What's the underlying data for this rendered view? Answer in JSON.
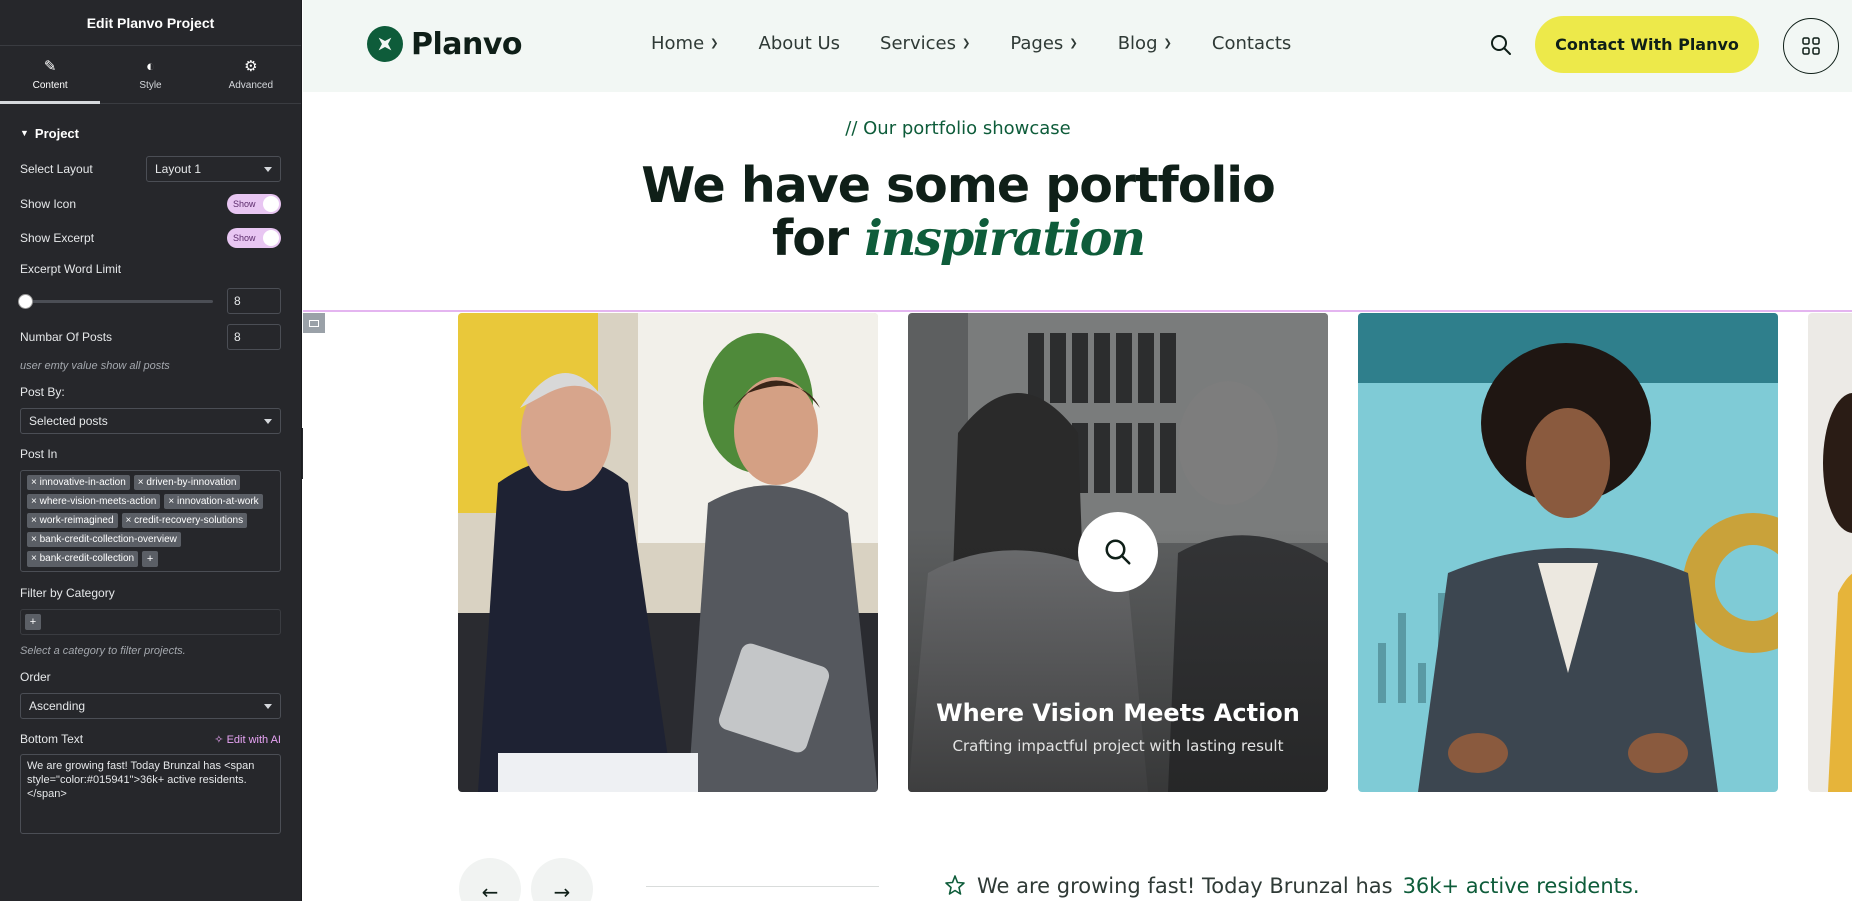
{
  "editor": {
    "title": "Edit Planvo Project",
    "tabs": [
      {
        "label": "Content",
        "icon": "pencil-icon"
      },
      {
        "label": "Style",
        "icon": "half-circle-icon"
      },
      {
        "label": "Advanced",
        "icon": "gear-icon"
      }
    ],
    "section": "Project",
    "layout_label": "Select Layout",
    "layout_value": "Layout 1",
    "show_icon_label": "Show Icon",
    "show_icon_value": "Show",
    "show_excerpt_label": "Show Excerpt",
    "show_excerpt_value": "Show",
    "excerpt_limit_label": "Excerpt Word Limit",
    "excerpt_limit_value": "8",
    "posts_label": "Numbar Of Posts",
    "posts_value": "8",
    "posts_hint": "user emty value show all posts",
    "post_by_label": "Post By:",
    "post_by_value": "Selected posts",
    "post_in_label": "Post In",
    "post_in_tags": [
      "innovative-in-action",
      "driven-by-innovation",
      "where-vision-meets-action",
      "innovation-at-work",
      "work-reimagined",
      "credit-recovery-solutions",
      "bank-credit-collection-overview",
      "bank-credit-collection"
    ],
    "filter_label": "Filter by Category",
    "filter_hint": "Select a category to filter projects.",
    "order_label": "Order",
    "order_value": "Ascending",
    "bottom_text_label": "Bottom Text",
    "edit_ai_label": "Edit with AI",
    "bottom_text_value": "We are growing fast! Today Brunzal has <span style=\"color:#015941\">36k+ active residents.</span>"
  },
  "site": {
    "logo": "Planvo",
    "menu": [
      {
        "label": "Home",
        "dropdown": true
      },
      {
        "label": "About Us",
        "dropdown": false
      },
      {
        "label": "Services",
        "dropdown": true
      },
      {
        "label": "Pages",
        "dropdown": true
      },
      {
        "label": "Blog",
        "dropdown": true
      },
      {
        "label": "Contacts",
        "dropdown": false
      }
    ],
    "cta": "Contact With Planvo",
    "subtitle": "// Our portfolio showcase",
    "heading_line1": "We have some portfolio",
    "heading_line2_plain": "for",
    "heading_line2_italic": "inspiration",
    "card_title": "Where Vision Meets Action",
    "card_excerpt": "Crafting impactful project with lasting result",
    "bottom_prefix": "We are growing fast! Today Brunzal has",
    "bottom_highlight": "36k+ active residents.",
    "colors": {
      "brand_green": "#0e5c3a",
      "cta_yellow": "#ede94a",
      "nav_bg": "#f2f7f4"
    }
  }
}
